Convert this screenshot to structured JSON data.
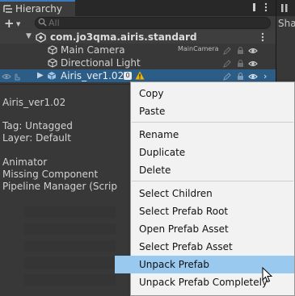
{
  "window": {
    "tab_title": "Hierarchy",
    "right_tab_label": "Sha"
  },
  "toolbar": {
    "add_label": "+",
    "search_placeholder": "All"
  },
  "hierarchy": {
    "scene_name": "com.jo3qma.airis.standard",
    "items": [
      {
        "label": "Main Camera",
        "tag": "MainCamera"
      },
      {
        "label": "Directional Light"
      },
      {
        "label": "Airis_ver1.02",
        "badge": "0"
      }
    ]
  },
  "inspector": {
    "object_name": "Airis_ver1.02",
    "tag_line": "Tag: Untagged",
    "layer_line": "Layer: Default",
    "components": [
      "Animator",
      "Missing Component",
      "Pipeline Manager (Scrip"
    ]
  },
  "context_menu": {
    "items": [
      "Copy",
      "Paste",
      "Rename",
      "Duplicate",
      "Delete",
      "Select Children",
      "Select Prefab Root",
      "Open Prefab Asset",
      "Select Prefab Asset",
      "Unpack Prefab",
      "Unpack Prefab Completely"
    ],
    "highlighted": "Unpack Prefab"
  },
  "colors": {
    "accent": "#3a79bb",
    "selection": "#2c5d87",
    "menu_highlight": "#99c9ef",
    "warning": "#f0b400"
  },
  "icons": [
    "hierarchy-icon",
    "kebab-menu-icon",
    "search-icon",
    "unity-scene-icon",
    "gameobject-cube-icon",
    "prefab-cube-icon",
    "warning-icon",
    "pencil-icon",
    "lock-icon",
    "eye-icon",
    "chevron-right-icon",
    "mouse-cursor-icon"
  ]
}
